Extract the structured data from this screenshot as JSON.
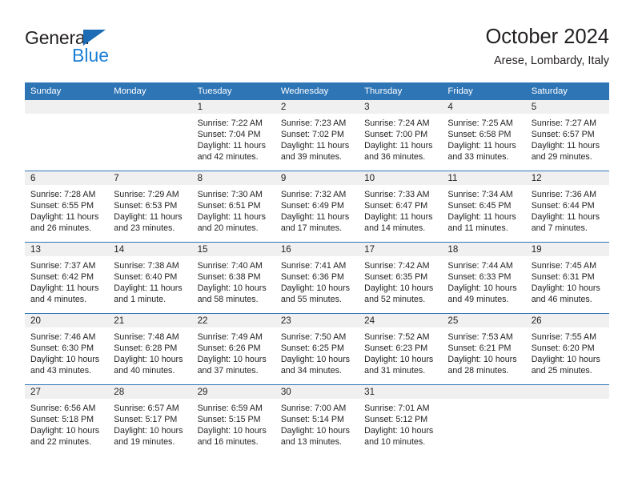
{
  "brand": {
    "name_part1": "General",
    "name_part2": "Blue",
    "triangle_color": "#1c6cb5",
    "blue_color": "#1c7fd6"
  },
  "header": {
    "title": "October 2024",
    "subtitle": "Arese, Lombardy, Italy"
  },
  "theme": {
    "header_bg": "#2e75b6",
    "daynum_bg": "#f0f0f0",
    "text": "#231f20"
  },
  "weekday_headers": [
    "Sunday",
    "Monday",
    "Tuesday",
    "Wednesday",
    "Thursday",
    "Friday",
    "Saturday"
  ],
  "weeks": [
    [
      {
        "day": "",
        "sunrise": "",
        "sunset": "",
        "daylight_a": "",
        "daylight_b": "",
        "empty": true
      },
      {
        "day": "",
        "sunrise": "",
        "sunset": "",
        "daylight_a": "",
        "daylight_b": "",
        "empty": true
      },
      {
        "day": "1",
        "sunrise": "Sunrise: 7:22 AM",
        "sunset": "Sunset: 7:04 PM",
        "daylight_a": "Daylight: 11 hours",
        "daylight_b": "and 42 minutes."
      },
      {
        "day": "2",
        "sunrise": "Sunrise: 7:23 AM",
        "sunset": "Sunset: 7:02 PM",
        "daylight_a": "Daylight: 11 hours",
        "daylight_b": "and 39 minutes."
      },
      {
        "day": "3",
        "sunrise": "Sunrise: 7:24 AM",
        "sunset": "Sunset: 7:00 PM",
        "daylight_a": "Daylight: 11 hours",
        "daylight_b": "and 36 minutes."
      },
      {
        "day": "4",
        "sunrise": "Sunrise: 7:25 AM",
        "sunset": "Sunset: 6:58 PM",
        "daylight_a": "Daylight: 11 hours",
        "daylight_b": "and 33 minutes."
      },
      {
        "day": "5",
        "sunrise": "Sunrise: 7:27 AM",
        "sunset": "Sunset: 6:57 PM",
        "daylight_a": "Daylight: 11 hours",
        "daylight_b": "and 29 minutes."
      }
    ],
    [
      {
        "day": "6",
        "sunrise": "Sunrise: 7:28 AM",
        "sunset": "Sunset: 6:55 PM",
        "daylight_a": "Daylight: 11 hours",
        "daylight_b": "and 26 minutes."
      },
      {
        "day": "7",
        "sunrise": "Sunrise: 7:29 AM",
        "sunset": "Sunset: 6:53 PM",
        "daylight_a": "Daylight: 11 hours",
        "daylight_b": "and 23 minutes."
      },
      {
        "day": "8",
        "sunrise": "Sunrise: 7:30 AM",
        "sunset": "Sunset: 6:51 PM",
        "daylight_a": "Daylight: 11 hours",
        "daylight_b": "and 20 minutes."
      },
      {
        "day": "9",
        "sunrise": "Sunrise: 7:32 AM",
        "sunset": "Sunset: 6:49 PM",
        "daylight_a": "Daylight: 11 hours",
        "daylight_b": "and 17 minutes."
      },
      {
        "day": "10",
        "sunrise": "Sunrise: 7:33 AM",
        "sunset": "Sunset: 6:47 PM",
        "daylight_a": "Daylight: 11 hours",
        "daylight_b": "and 14 minutes."
      },
      {
        "day": "11",
        "sunrise": "Sunrise: 7:34 AM",
        "sunset": "Sunset: 6:45 PM",
        "daylight_a": "Daylight: 11 hours",
        "daylight_b": "and 11 minutes."
      },
      {
        "day": "12",
        "sunrise": "Sunrise: 7:36 AM",
        "sunset": "Sunset: 6:44 PM",
        "daylight_a": "Daylight: 11 hours",
        "daylight_b": "and 7 minutes."
      }
    ],
    [
      {
        "day": "13",
        "sunrise": "Sunrise: 7:37 AM",
        "sunset": "Sunset: 6:42 PM",
        "daylight_a": "Daylight: 11 hours",
        "daylight_b": "and 4 minutes."
      },
      {
        "day": "14",
        "sunrise": "Sunrise: 7:38 AM",
        "sunset": "Sunset: 6:40 PM",
        "daylight_a": "Daylight: 11 hours",
        "daylight_b": "and 1 minute."
      },
      {
        "day": "15",
        "sunrise": "Sunrise: 7:40 AM",
        "sunset": "Sunset: 6:38 PM",
        "daylight_a": "Daylight: 10 hours",
        "daylight_b": "and 58 minutes."
      },
      {
        "day": "16",
        "sunrise": "Sunrise: 7:41 AM",
        "sunset": "Sunset: 6:36 PM",
        "daylight_a": "Daylight: 10 hours",
        "daylight_b": "and 55 minutes."
      },
      {
        "day": "17",
        "sunrise": "Sunrise: 7:42 AM",
        "sunset": "Sunset: 6:35 PM",
        "daylight_a": "Daylight: 10 hours",
        "daylight_b": "and 52 minutes."
      },
      {
        "day": "18",
        "sunrise": "Sunrise: 7:44 AM",
        "sunset": "Sunset: 6:33 PM",
        "daylight_a": "Daylight: 10 hours",
        "daylight_b": "and 49 minutes."
      },
      {
        "day": "19",
        "sunrise": "Sunrise: 7:45 AM",
        "sunset": "Sunset: 6:31 PM",
        "daylight_a": "Daylight: 10 hours",
        "daylight_b": "and 46 minutes."
      }
    ],
    [
      {
        "day": "20",
        "sunrise": "Sunrise: 7:46 AM",
        "sunset": "Sunset: 6:30 PM",
        "daylight_a": "Daylight: 10 hours",
        "daylight_b": "and 43 minutes."
      },
      {
        "day": "21",
        "sunrise": "Sunrise: 7:48 AM",
        "sunset": "Sunset: 6:28 PM",
        "daylight_a": "Daylight: 10 hours",
        "daylight_b": "and 40 minutes."
      },
      {
        "day": "22",
        "sunrise": "Sunrise: 7:49 AM",
        "sunset": "Sunset: 6:26 PM",
        "daylight_a": "Daylight: 10 hours",
        "daylight_b": "and 37 minutes."
      },
      {
        "day": "23",
        "sunrise": "Sunrise: 7:50 AM",
        "sunset": "Sunset: 6:25 PM",
        "daylight_a": "Daylight: 10 hours",
        "daylight_b": "and 34 minutes."
      },
      {
        "day": "24",
        "sunrise": "Sunrise: 7:52 AM",
        "sunset": "Sunset: 6:23 PM",
        "daylight_a": "Daylight: 10 hours",
        "daylight_b": "and 31 minutes."
      },
      {
        "day": "25",
        "sunrise": "Sunrise: 7:53 AM",
        "sunset": "Sunset: 6:21 PM",
        "daylight_a": "Daylight: 10 hours",
        "daylight_b": "and 28 minutes."
      },
      {
        "day": "26",
        "sunrise": "Sunrise: 7:55 AM",
        "sunset": "Sunset: 6:20 PM",
        "daylight_a": "Daylight: 10 hours",
        "daylight_b": "and 25 minutes."
      }
    ],
    [
      {
        "day": "27",
        "sunrise": "Sunrise: 6:56 AM",
        "sunset": "Sunset: 5:18 PM",
        "daylight_a": "Daylight: 10 hours",
        "daylight_b": "and 22 minutes."
      },
      {
        "day": "28",
        "sunrise": "Sunrise: 6:57 AM",
        "sunset": "Sunset: 5:17 PM",
        "daylight_a": "Daylight: 10 hours",
        "daylight_b": "and 19 minutes."
      },
      {
        "day": "29",
        "sunrise": "Sunrise: 6:59 AM",
        "sunset": "Sunset: 5:15 PM",
        "daylight_a": "Daylight: 10 hours",
        "daylight_b": "and 16 minutes."
      },
      {
        "day": "30",
        "sunrise": "Sunrise: 7:00 AM",
        "sunset": "Sunset: 5:14 PM",
        "daylight_a": "Daylight: 10 hours",
        "daylight_b": "and 13 minutes."
      },
      {
        "day": "31",
        "sunrise": "Sunrise: 7:01 AM",
        "sunset": "Sunset: 5:12 PM",
        "daylight_a": "Daylight: 10 hours",
        "daylight_b": "and 10 minutes."
      },
      {
        "day": "",
        "sunrise": "",
        "sunset": "",
        "daylight_a": "",
        "daylight_b": "",
        "empty": true
      },
      {
        "day": "",
        "sunrise": "",
        "sunset": "",
        "daylight_a": "",
        "daylight_b": "",
        "empty": true
      }
    ]
  ]
}
